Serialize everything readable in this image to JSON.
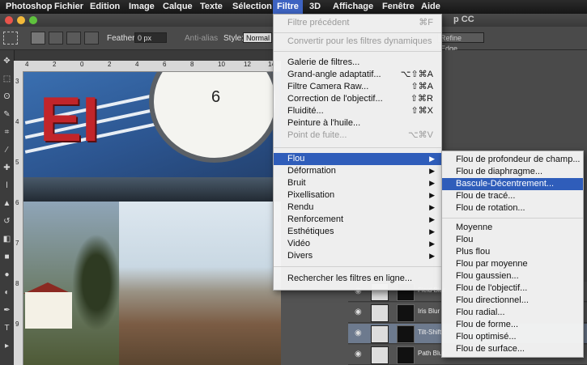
{
  "menubar": {
    "app": "Photoshop",
    "items": [
      "Fichier",
      "Edition",
      "Image",
      "Calque",
      "Texte",
      "Sélection",
      "Filtre",
      "3D",
      "Affichage",
      "Fenêtre",
      "Aide"
    ],
    "active": "Filtre"
  },
  "window": {
    "title_fragment": "p CC"
  },
  "colors": {
    "accent": "#3d63c2",
    "menu_highlight": "#2f5dba",
    "close": "#e9544b",
    "minimize": "#f3b93a",
    "zoom": "#5fc23d"
  },
  "options": {
    "feather_label": "Feather:",
    "feather_value": "0 px",
    "antialias_label": "Anti-alias",
    "style_label": "Style:",
    "style_value": "Normal",
    "refine_label": "Refine Edge..."
  },
  "ruler": {
    "h": [
      "4",
      "2",
      "0",
      "2",
      "4",
      "6",
      "8",
      "10",
      "12",
      "14"
    ],
    "v": [
      "3",
      "4",
      "5",
      "6",
      "7",
      "8",
      "9"
    ]
  },
  "photo": {
    "clock_digit": "6"
  },
  "layers": [
    {
      "name": "Field Blur",
      "selected": false
    },
    {
      "name": "Iris Blur",
      "selected": false
    },
    {
      "name": "Tilt-Shift",
      "selected": true
    },
    {
      "name": "Path Blur",
      "selected": false
    }
  ],
  "filtre_menu": {
    "items": [
      {
        "label": "Filtre précédent",
        "shortcut": "⌘F",
        "disabled": true
      },
      {
        "label": "Convertir pour les filtres dynamiques",
        "disabled": true
      },
      {
        "label": "Galerie de filtres..."
      },
      {
        "label": "Grand-angle adaptatif...",
        "shortcut": "⌥⇧⌘A"
      },
      {
        "label": "Filtre Camera Raw...",
        "shortcut": "⇧⌘A"
      },
      {
        "label": "Correction de l'objectif...",
        "shortcut": "⇧⌘R"
      },
      {
        "label": "Fluidité...",
        "shortcut": "⇧⌘X"
      },
      {
        "label": "Peinture à l'huile..."
      },
      {
        "label": "Point de fuite...",
        "shortcut": "⌥⌘V",
        "disabled": true
      },
      {
        "label": "Flou",
        "submenu": true,
        "highlighted": true
      },
      {
        "label": "Déformation",
        "submenu": true
      },
      {
        "label": "Bruit",
        "submenu": true
      },
      {
        "label": "Pixellisation",
        "submenu": true
      },
      {
        "label": "Rendu",
        "submenu": true
      },
      {
        "label": "Renforcement",
        "submenu": true
      },
      {
        "label": "Esthétiques",
        "submenu": true
      },
      {
        "label": "Vidéo",
        "submenu": true
      },
      {
        "label": "Divers",
        "submenu": true
      },
      {
        "label": "Rechercher les filtres en ligne..."
      }
    ]
  },
  "flou_menu": {
    "items": [
      {
        "label": "Flou de profondeur de champ..."
      },
      {
        "label": "Flou de diaphragme..."
      },
      {
        "label": "Bascule-Décentrement...",
        "highlighted": true
      },
      {
        "label": "Flou de tracé..."
      },
      {
        "label": "Flou de rotation..."
      },
      {
        "label": "Moyenne"
      },
      {
        "label": "Flou"
      },
      {
        "label": "Plus flou"
      },
      {
        "label": "Flou par moyenne"
      },
      {
        "label": "Flou gaussien..."
      },
      {
        "label": "Flou de l'objectif..."
      },
      {
        "label": "Flou directionnel..."
      },
      {
        "label": "Flou radial..."
      },
      {
        "label": "Flou de forme..."
      },
      {
        "label": "Flou optimisé..."
      },
      {
        "label": "Flou de surface..."
      }
    ]
  }
}
